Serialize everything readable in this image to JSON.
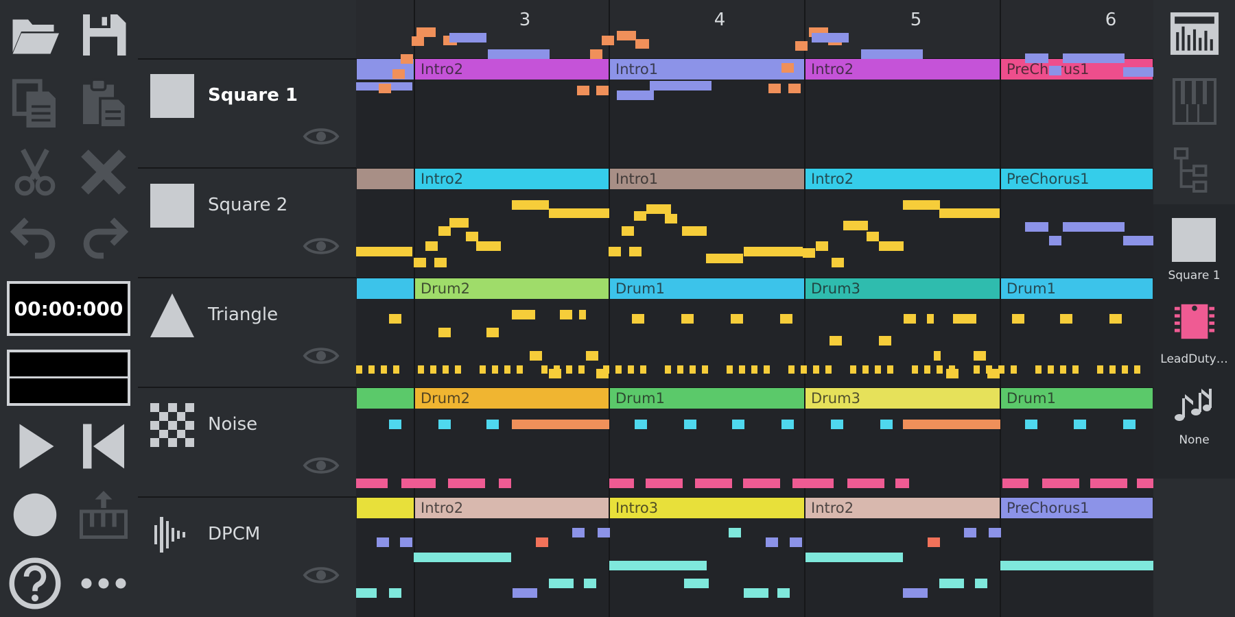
{
  "timer": "00:00:000",
  "bars": [
    "3",
    "4",
    "5",
    "6"
  ],
  "channels": [
    {
      "name": "Square 1",
      "icon": "square-wave-icon",
      "active": true,
      "patterns": [
        {
          "label": "",
          "color": "#8c93e8"
        },
        {
          "label": "Intro2",
          "color": "#c553d8"
        },
        {
          "label": "Intro1",
          "color": "#8c93e8"
        },
        {
          "label": "Intro2",
          "color": "#c553d8"
        },
        {
          "label": "PreChorus1",
          "color": "#ee4e8c"
        }
      ]
    },
    {
      "name": "Square 2",
      "icon": "square-wave-icon",
      "active": false,
      "patterns": [
        {
          "label": "",
          "color": "#a88f86"
        },
        {
          "label": "Intro2",
          "color": "#35cdea"
        },
        {
          "label": "Intro1",
          "color": "#a88f86"
        },
        {
          "label": "Intro2",
          "color": "#35cdea"
        },
        {
          "label": "PreChorus1",
          "color": "#35cdea"
        }
      ]
    },
    {
      "name": "Triangle",
      "icon": "triangle-wave-icon",
      "active": false,
      "patterns": [
        {
          "label": "",
          "color": "#3cc3ea"
        },
        {
          "label": "Drum2",
          "color": "#9fdc6a"
        },
        {
          "label": "Drum1",
          "color": "#3cc3ea"
        },
        {
          "label": "Drum3",
          "color": "#2fbcae"
        },
        {
          "label": "Drum1",
          "color": "#3cc3ea"
        }
      ]
    },
    {
      "name": "Noise",
      "icon": "noise-icon",
      "active": false,
      "patterns": [
        {
          "label": "",
          "color": "#5bc96a"
        },
        {
          "label": "Drum2",
          "color": "#f0b531"
        },
        {
          "label": "Drum1",
          "color": "#5bc96a"
        },
        {
          "label": "Drum3",
          "color": "#e6e15a"
        },
        {
          "label": "Drum1",
          "color": "#5bc96a"
        }
      ]
    },
    {
      "name": "DPCM",
      "icon": "dpcm-waveform-icon",
      "active": false,
      "patterns": [
        {
          "label": "",
          "color": "#e8e03a"
        },
        {
          "label": "Intro2",
          "color": "#d8b8ae"
        },
        {
          "label": "Intro3",
          "color": "#e8e03a"
        },
        {
          "label": "Intro2",
          "color": "#d8b8ae"
        },
        {
          "label": "PreChorus1",
          "color": "#8c93e8"
        }
      ]
    }
  ],
  "right_panel": {
    "instrument_label": "Square 1",
    "arpeggio_label": "LeadDuty…",
    "none_label": "None"
  },
  "colors": {
    "orange": "#f0905a",
    "blue": "#8c93e8",
    "yellow": "#f6cd3a",
    "cyan": "#4fd8ee",
    "pink": "#ef5b93",
    "mint": "#7fe8dc",
    "salmon": "#f2725a"
  }
}
